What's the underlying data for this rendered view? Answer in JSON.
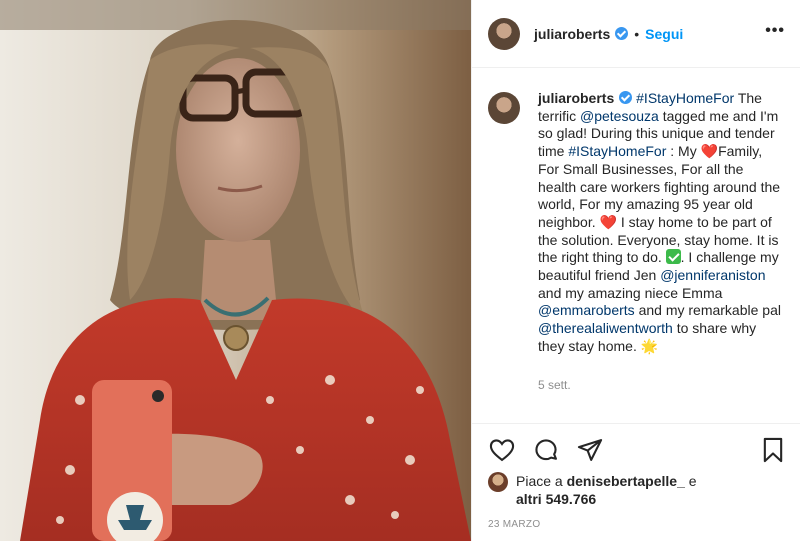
{
  "post": {
    "username": "juliaroberts",
    "follow_label": "Segui",
    "dot": "•",
    "more_label": "•••",
    "caption": {
      "hashtag1": "#IStayHomeFor",
      "t1": " The terrific ",
      "mention1": "@petesouza",
      "t2": " tagged me and I'm so glad! During this unique and tender time ",
      "hashtag2": "#IStayHomeFor",
      "t3": " : My ",
      "heart1": "❤️",
      "t4": "Family, For Small Businesses, For all the health care workers fighting around the world, For my amazing 95 year old neighbor. ",
      "heart2": "❤️",
      "t5": " I stay home to be part of the solution. Everyone, stay home. It is the right thing to do. ",
      "t6": ". I challenge my beautiful friend Jen ",
      "mention2": "@jenniferaniston",
      "t7": " and my amazing niece Emma ",
      "mention3": "@emmaroberts",
      "t8": " and my remarkable pal ",
      "mention4": "@therealaliwentworth",
      "t9": " to share why they stay home. ",
      "star": "🌟"
    },
    "time_ago": "5 sett.",
    "likes": {
      "prefix": "Piace a ",
      "user": "denisebertapelle_",
      "mid": " e",
      "others": "altri 549.766"
    },
    "date": "23 MARZO"
  },
  "icons": {
    "like": "heart-outline-icon",
    "comment": "speech-bubble-icon",
    "share": "paper-plane-icon",
    "save": "bookmark-icon",
    "verified": "verified-badge-icon"
  },
  "colors": {
    "accent": "#0095f6",
    "link": "#00376b",
    "verified": "#3897f0",
    "muted": "#8e8e8e"
  }
}
